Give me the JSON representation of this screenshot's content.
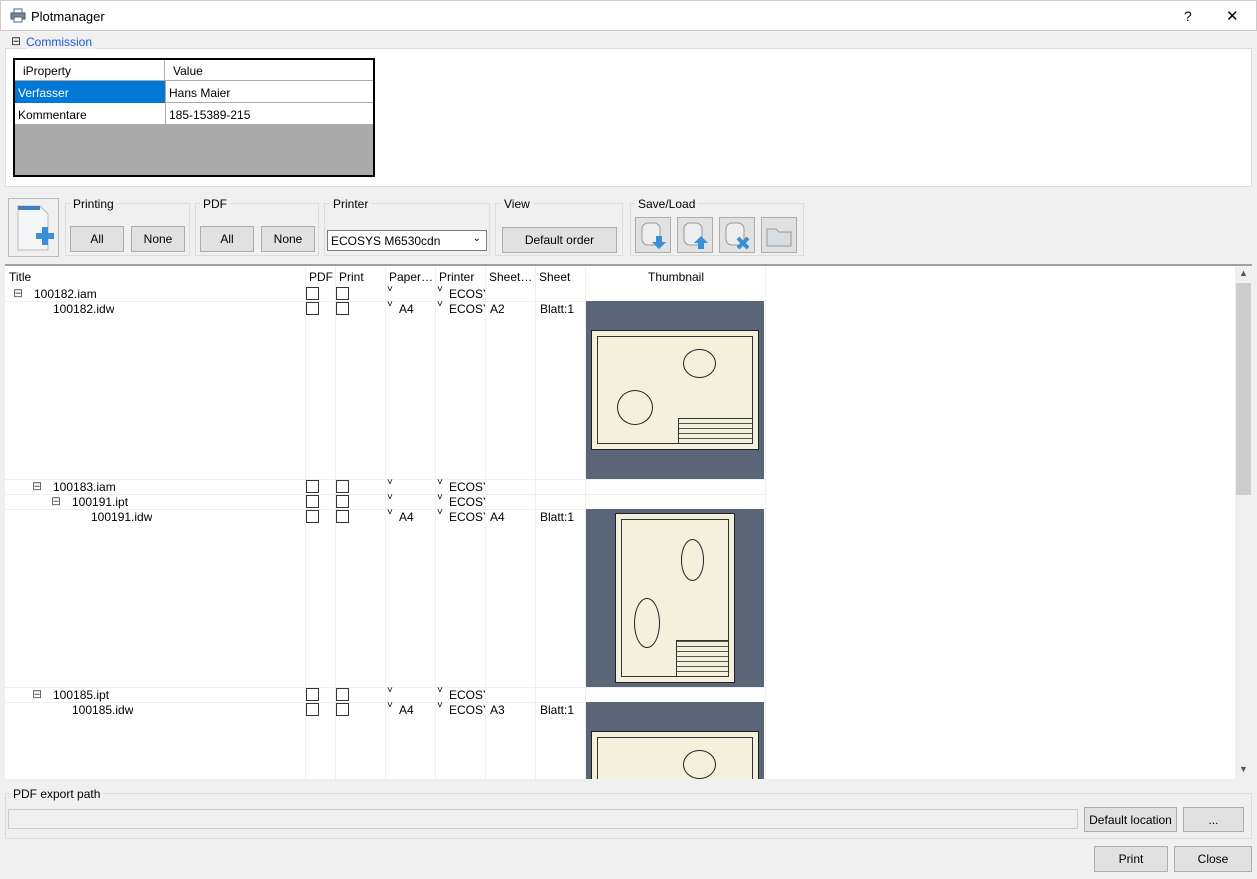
{
  "window": {
    "title": "Plotmanager",
    "help": "?",
    "close": "✕"
  },
  "commission": {
    "label": "Commission",
    "collapse": "⊟",
    "headers": [
      "iProperty",
      "Value"
    ],
    "rows": [
      {
        "prop": "Verfasser",
        "value": "Hans Maier"
      },
      {
        "prop": "Kommentare",
        "value": "185-15389-215"
      }
    ]
  },
  "toolbar": {
    "printing": {
      "label": "Printing",
      "all": "All",
      "none": "None"
    },
    "pdf": {
      "label": "PDF",
      "all": "All",
      "none": "None"
    },
    "printer": {
      "label": "Printer",
      "selected": "ECOSYS M6530cdn"
    },
    "view": {
      "label": "View",
      "default_order": "Default order"
    },
    "saveload": {
      "label": "Save/Load"
    }
  },
  "grid": {
    "columns": [
      "Title",
      "PDF",
      "Print",
      "Paper…",
      "Printer",
      "Sheet…",
      "Sheet",
      "Thumbnail"
    ],
    "rows": [
      {
        "title": "100182.iam",
        "level": 0,
        "expander": "⊟",
        "paper": "",
        "printer": "ECOSY",
        "size": "",
        "sheet": "",
        "thumb": false
      },
      {
        "title": "100182.idw",
        "level": 1,
        "expander": "",
        "paper": "A4",
        "printer": "ECOSY",
        "size": "A2",
        "sheet": "Blatt:1",
        "thumb": "landscape"
      },
      {
        "title": "100183.iam",
        "level": 1,
        "expander": "⊟",
        "paper": "",
        "printer": "ECOSY",
        "size": "",
        "sheet": "",
        "thumb": false
      },
      {
        "title": "100191.ipt",
        "level": 2,
        "expander": "⊟",
        "paper": "",
        "printer": "ECOSY",
        "size": "",
        "sheet": "",
        "thumb": false
      },
      {
        "title": "100191.idw",
        "level": 3,
        "expander": "",
        "paper": "A4",
        "printer": "ECOSY",
        "size": "A4",
        "sheet": "Blatt:1",
        "thumb": "portrait"
      },
      {
        "title": "100185.ipt",
        "level": 1,
        "expander": "⊟",
        "paper": "",
        "printer": "ECOSY",
        "size": "",
        "sheet": "",
        "thumb": false
      },
      {
        "title": "100185.idw",
        "level": 2,
        "expander": "",
        "paper": "A4",
        "printer": "ECOSY",
        "size": "A3",
        "sheet": "Blatt:1",
        "thumb": "landscape"
      }
    ]
  },
  "export": {
    "label": "PDF export path",
    "path": "",
    "default_location": "Default location",
    "browse": "..."
  },
  "footer": {
    "print": "Print",
    "close": "Close"
  }
}
